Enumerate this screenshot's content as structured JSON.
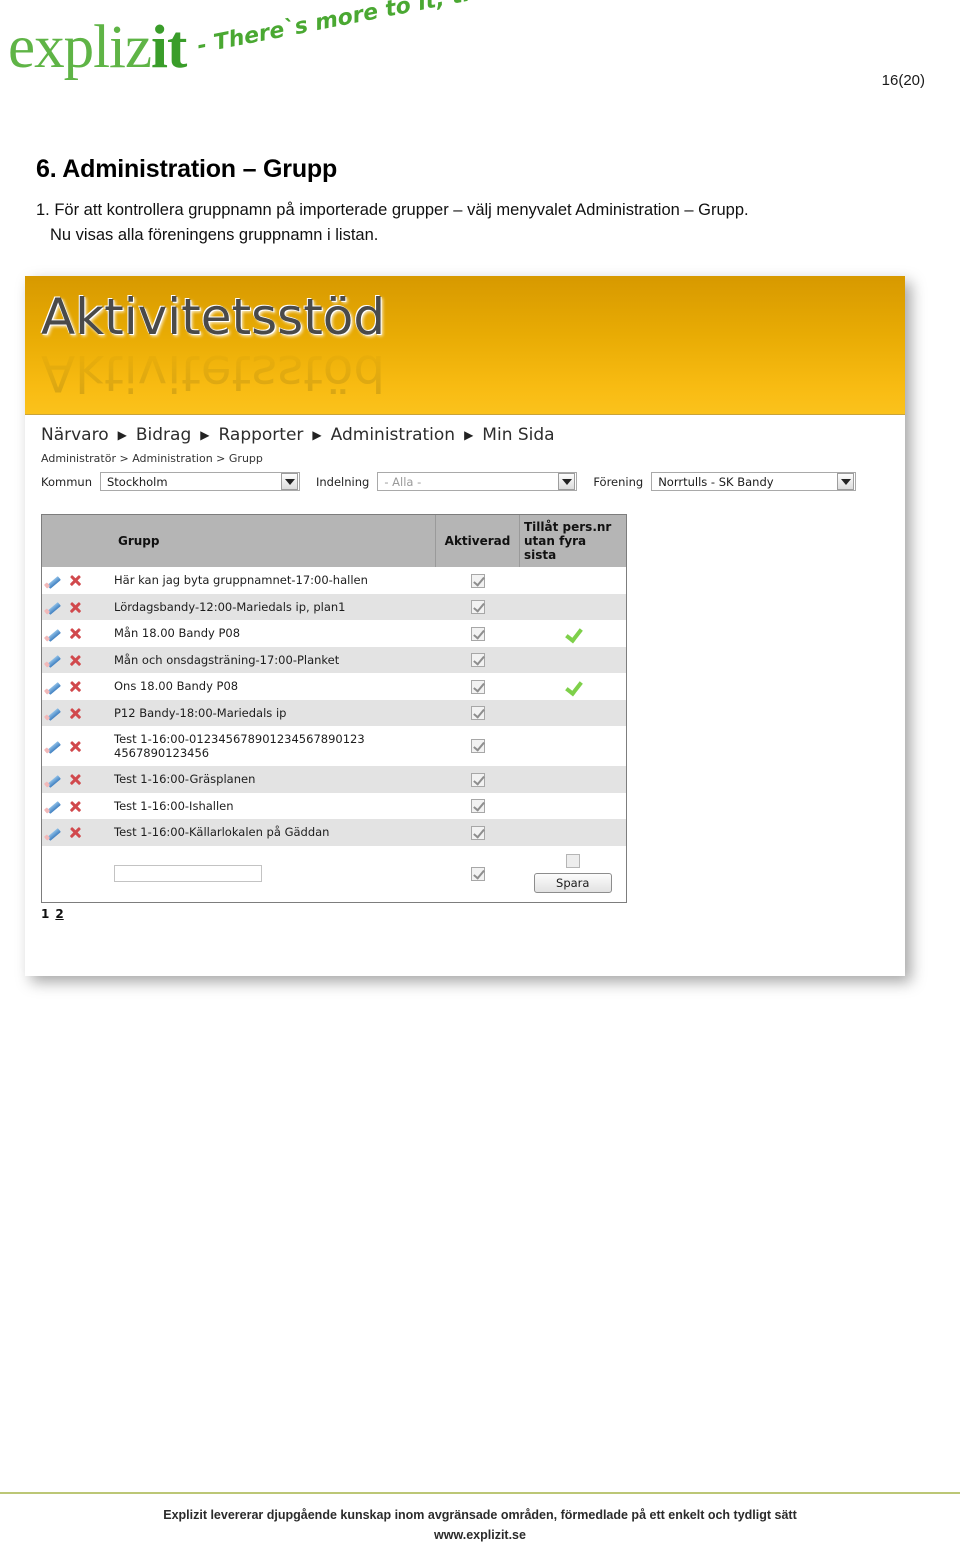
{
  "document": {
    "page_number": "16(20)",
    "logo": {
      "text_part1": "expliz",
      "text_accent": "it",
      "tagline": "- There`s more to it, than IT!"
    },
    "heading": "6. Administration – Grupp",
    "step_line1": "1. För att kontrollera gruppnamn på importerade grupper – välj menyvalet Administration – Grupp.",
    "step_line2": "Nu visas alla föreningens gruppnamn i listan.",
    "footer_line1": "Explizit levererar djupgående kunskap inom avgränsade områden, förmedlade på ett enkelt och tydligt sätt",
    "footer_line2": "www.explizit.se"
  },
  "screenshot": {
    "app_title": "Aktivitetsstöd",
    "nav": {
      "items": [
        {
          "label": "Närvaro"
        },
        {
          "label": "Bidrag"
        },
        {
          "label": "Rapporter"
        },
        {
          "label": "Administration"
        },
        {
          "label": "Min Sida"
        }
      ],
      "separator": "▶"
    },
    "breadcrumb": "Administratör > Administration > Grupp",
    "filters": [
      {
        "label": "Kommun",
        "value": "Stockholm",
        "muted": false
      },
      {
        "label": "Indelning",
        "value": "- Alla -",
        "muted": true
      },
      {
        "label": "Förening",
        "value": "Norrtulls - SK Bandy",
        "muted": false
      }
    ],
    "table": {
      "headers": {
        "actions": "",
        "grupp": "Grupp",
        "aktiverad": "Aktiverad",
        "tillat_line1": "Tillåt pers.nr",
        "tillat_line2": "utan fyra sista"
      },
      "rows": [
        {
          "name": "Här kan jag byta gruppnamnet-17:00-hallen",
          "aktiverad": true,
          "tillat": false
        },
        {
          "name": "Lördagsbandy-12:00-Mariedals ip, plan1",
          "aktiverad": true,
          "tillat": false
        },
        {
          "name": "Mån 18.00 Bandy P08",
          "aktiverad": true,
          "tillat": true
        },
        {
          "name": "Mån och onsdagsträning-17:00-Planket",
          "aktiverad": true,
          "tillat": false
        },
        {
          "name": "Ons 18.00 Bandy P08",
          "aktiverad": true,
          "tillat": true
        },
        {
          "name": "P12 Bandy-18:00-Mariedals ip",
          "aktiverad": true,
          "tillat": false
        },
        {
          "name": "Test 1-16:00-012345678901234567890123 4567890123456",
          "aktiverad": true,
          "tillat": false
        },
        {
          "name": "Test 1-16:00-Gräsplanen",
          "aktiverad": true,
          "tillat": false
        },
        {
          "name": "Test 1-16:00-Ishallen",
          "aktiverad": true,
          "tillat": false
        },
        {
          "name": "Test 1-16:00-Källarlokalen på Gäddan",
          "aktiverad": true,
          "tillat": false
        }
      ],
      "new_row": {
        "input_value": "",
        "input_placeholder": "",
        "aktiverad": true,
        "tillat_checked": false,
        "save_label": "Spara"
      }
    },
    "pagination": {
      "pages": [
        {
          "label": "1",
          "active": true
        },
        {
          "label": "2",
          "active": false
        }
      ]
    }
  },
  "colors": {
    "banner_top": "#d79900",
    "banner_bottom": "#fbc21c",
    "brand_green": "#5fb446",
    "footer_rule": "#bcc776",
    "row_alt": "#e3e3e3",
    "table_header": "#b5b5b5",
    "tick_green": "#7ed04a",
    "delete_red": "#d1494d",
    "edit_blue": "#3f7fc0"
  }
}
